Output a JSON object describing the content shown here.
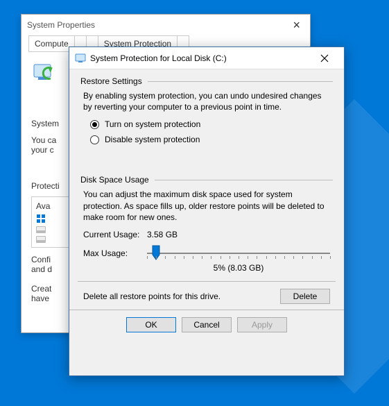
{
  "back": {
    "title": "System Properties",
    "tabs": [
      "Compute",
      " ",
      " ",
      "System Protection",
      " "
    ],
    "subtitle": "System",
    "line1": "You ca",
    "line2": "your c",
    "section_label": "Protecti",
    "avail": "Ava",
    "conf1": "Confi",
    "conf2": "and d",
    "create1": "Creat",
    "create2": "have"
  },
  "front": {
    "title": "System Protection for Local Disk (C:)",
    "restore": {
      "heading": "Restore Settings",
      "desc": "By enabling system protection, you can undo undesired changes by reverting your computer to a previous point in time.",
      "opt_on": "Turn on system protection",
      "opt_off": "Disable system protection",
      "selected": "on"
    },
    "disk": {
      "heading": "Disk Space Usage",
      "desc": "You can adjust the maximum disk space used for system protection. As space fills up, older restore points will be deleted to make room for new ones.",
      "current_label": "Current Usage:",
      "current_value": "3.58 GB",
      "max_label": "Max Usage:",
      "max_text": "5% (8.03 GB)",
      "slider_percent": 5
    },
    "delete": {
      "text": "Delete all restore points for this drive.",
      "button": "Delete"
    },
    "buttons": {
      "ok": "OK",
      "cancel": "Cancel",
      "apply": "Apply"
    }
  }
}
